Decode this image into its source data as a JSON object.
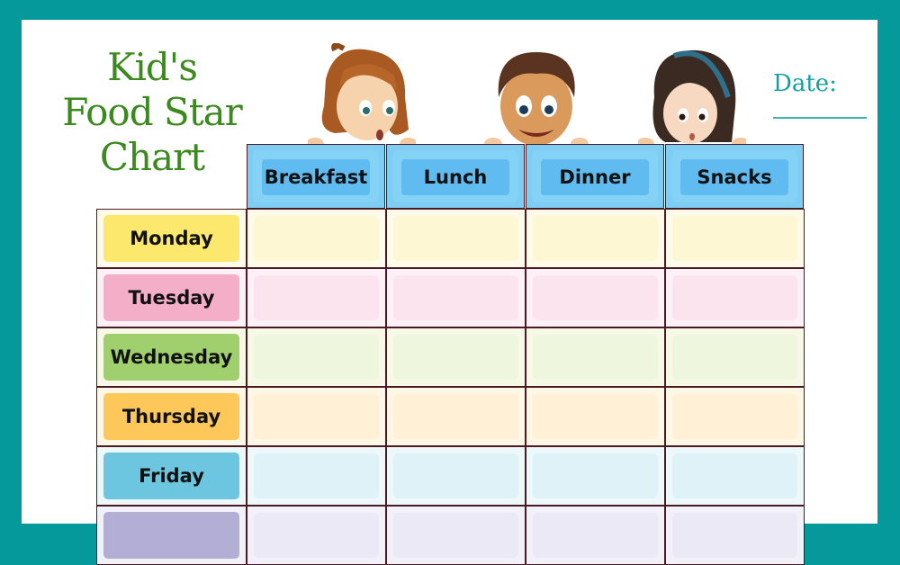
{
  "title": {
    "line1": "Kid's",
    "line2": "Food Star",
    "line3": "Chart"
  },
  "date": {
    "label": "Date:",
    "value": ""
  },
  "columns": [
    "Breakfast",
    "Lunch",
    "Dinner",
    "Snacks"
  ],
  "rows": [
    {
      "day": "Monday",
      "label_bg": "#fde86e",
      "row_bg": "#fffbe8",
      "cell_bg": "#fdf7d3"
    },
    {
      "day": "Tuesday",
      "label_bg": "#f4aec8",
      "row_bg": "#fdf0f6",
      "cell_bg": "#fce4ee"
    },
    {
      "day": "Wednesday",
      "label_bg": "#a0cf6e",
      "row_bg": "#f7f8e6",
      "cell_bg": "#eef6de"
    },
    {
      "day": "Thursday",
      "label_bg": "#fdc75a",
      "row_bg": "#fff7e6",
      "cell_bg": "#fff0d6"
    },
    {
      "day": "Friday",
      "label_bg": "#6cc6df",
      "row_bg": "#edf8fb",
      "cell_bg": "#def2f7"
    },
    {
      "day": "",
      "label_bg": "#b3aed6",
      "row_bg": "#f2f1fa",
      "cell_bg": "#ebe9f6"
    }
  ],
  "colors": {
    "frame": "#05999c",
    "title": "#3b8a1e",
    "header": "#7ecdf4",
    "grid_line": "#4a1a22"
  },
  "illustrations": [
    "girl-ponytail-illustration",
    "boy-smiling-illustration",
    "girl-headband-illustration"
  ]
}
